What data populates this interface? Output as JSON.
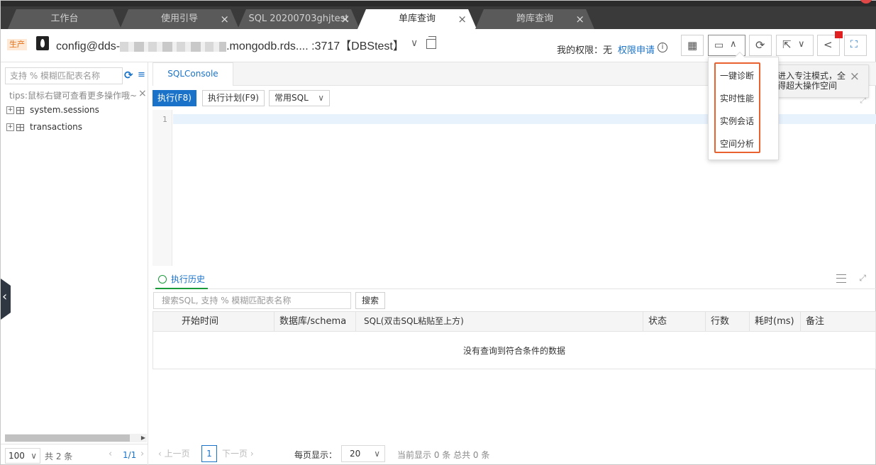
{
  "tabs": [
    {
      "label": "工作台",
      "closable": false
    },
    {
      "label": "使用引导",
      "closable": true
    },
    {
      "label": "SQL 20200703ghjtest",
      "closable": true
    },
    {
      "label": "单库查询",
      "closable": true,
      "active": true
    },
    {
      "label": "跨库查询",
      "closable": true
    }
  ],
  "connection": {
    "env_badge": "生产",
    "prefix": "config@dds-",
    "suffix": ".mongodb.rds.... :3717【DBStest】",
    "chevron": "∨",
    "permission_label": "我的权限：无",
    "permission_link": "权限申请",
    "info_icon": "i"
  },
  "toolbar": {
    "table_icon": "table-icon",
    "monitor_icon": "monitor-icon",
    "refresh_icon": "refresh-icon",
    "export_icon": "export-icon",
    "share_icon": "share-icon",
    "fullscreen_icon": "fullscreen-icon"
  },
  "sidebar": {
    "search_placeholder": "支持 % 模糊匹配表名称",
    "tips": "tips:鼠标右键可查看更多操作哦~",
    "items": [
      {
        "label": "system.sessions"
      },
      {
        "label": "transactions"
      }
    ],
    "page_size": "100",
    "total": "共 2 条",
    "page": "1/1"
  },
  "console": {
    "tab_label": "SQLConsole",
    "run_label": "执行(F8)",
    "plan_label": "执行计划(F9)",
    "common_sql_label": "常用SQL",
    "line_number": "1"
  },
  "history": {
    "tab_label": "执行历史",
    "search_placeholder": "搜索SQL, 支持 % 模糊匹配表名称",
    "search_button": "搜索",
    "columns": [
      "开始时间",
      "数据库/schema",
      "SQL(双击SQL粘贴至上方)",
      "状态",
      "行数",
      "耗时(ms)",
      "备注"
    ],
    "empty_message": "没有查询到符合条件的数据",
    "prev_label": "上一页",
    "next_label": "下一页",
    "current_page": "1",
    "per_page_label": "每页显示：",
    "per_page_value": "20",
    "summary": "当前显示 0 条 总共 0 条"
  },
  "hint": {
    "line1": "进入专注模式，全",
    "line2": "得超大操作空间"
  },
  "dropdown": {
    "items": [
      "一键诊断",
      "实时性能",
      "实例会话",
      "空间分析"
    ]
  },
  "colors": {
    "accent": "#1a73c9",
    "highlight": "#e8612f",
    "tab_bar": "#3a3a3a"
  }
}
